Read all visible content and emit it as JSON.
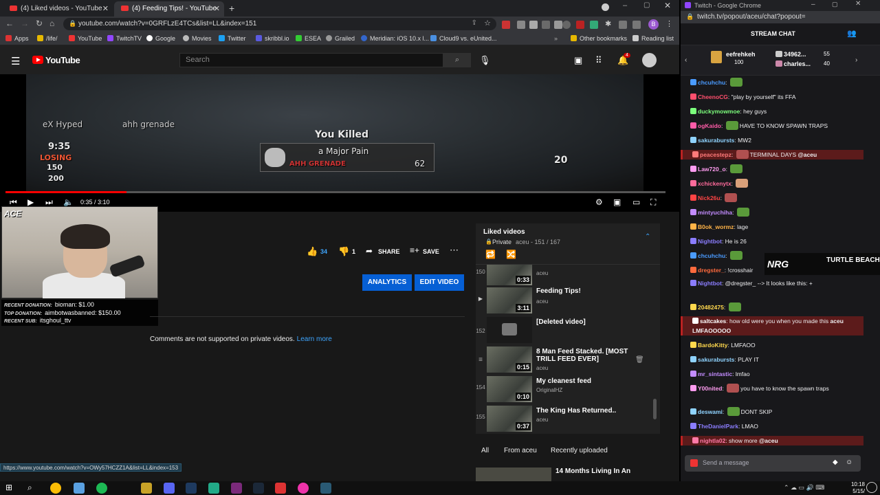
{
  "browser": {
    "tabs": [
      {
        "title": "(4) Liked videos - YouTube"
      },
      {
        "title": "(4) Feeding Tips! - YouTube"
      }
    ],
    "url": "youtube.com/watch?v=0GRFLzE4TCs&list=LL&index=151",
    "bookmarks": [
      "Apps",
      "/life/",
      "YouTube",
      "TwitchTV",
      "Google",
      "Movies",
      "Twitter",
      "skribbl.io",
      "ESEA",
      "Grailed",
      "Meridian: iOS 10.x l...",
      "Cloud9 vs. eUnited..."
    ],
    "other_bookmarks": "Other bookmarks",
    "reading_list": "Reading list",
    "profile_initial": "B"
  },
  "youtube": {
    "logo": "YouTube",
    "search_placeholder": "Search",
    "notif_count": "4",
    "video": {
      "hud": {
        "killfeed1": "eX Hyped",
        "killfeed1b": "ahh grenade",
        "time": "9:35",
        "status": "LOSING",
        "score1": "150",
        "score2": "200",
        "you_killed": "You Killed",
        "victim": "a Major Pain",
        "weapon": "AHH GRENADE",
        "points": "62",
        "ammo": "20"
      },
      "progress": 0.183,
      "time_display": "0:35 / 3:10"
    },
    "actions": {
      "likes": "34",
      "dislikes": "1",
      "share": "SHARE",
      "save": "SAVE",
      "analytics": "ANALYTICS",
      "edit_video": "EDIT VIDEO"
    },
    "comments_note": "Comments are not supported on private videos.",
    "learn_more": "Learn more",
    "playlist": {
      "title": "Liked videos",
      "privacy": "Private",
      "meta": "aceu - 151 / 167",
      "items": [
        {
          "idx": "150",
          "title": "",
          "channel": "aceu",
          "duration": "0:33"
        },
        {
          "idx": "",
          "title": "Feeding Tips!",
          "channel": "aceu",
          "duration": "3:11"
        },
        {
          "idx": "152",
          "title": "[Deleted video]",
          "channel": "",
          "duration": ""
        },
        {
          "idx": "",
          "title": "8 Man Feed Stacked. [MOST TRILL FEED EVER]",
          "channel": "aceu",
          "duration": "0:15"
        },
        {
          "idx": "154",
          "title": "My cleanest feed",
          "channel": "OriginalHZ",
          "duration": "0:10"
        },
        {
          "idx": "155",
          "title": "The King Has Returned..",
          "channel": "aceu",
          "duration": "0:37"
        }
      ]
    },
    "chips": [
      "All",
      "From aceu",
      "Recently uploaded"
    ],
    "next_video_title": "14 Months Living In An",
    "status_url": "https://www.youtube.com/watch?v=OWy57HCZZ1A&list=LL&index=153"
  },
  "overlay": {
    "tag": "ACE",
    "recent_donation_label": "RECENT DONATION:",
    "recent_donation": "bioman: $1.00",
    "top_donation_label": "TOP DONATION:",
    "top_donation": "aimbotwasbanned: $150.00",
    "recent_sub_label": "RECENT SUB:",
    "recent_sub": "itsghoul_ttv"
  },
  "twitch": {
    "window_title": "Twitch - Google Chrome",
    "url": "twitch.tv/popout/aceu/chat?popout=",
    "header": "STREAM CHAT",
    "gifts": [
      {
        "user": "eefrehkeh",
        "count": "100"
      },
      {
        "user": "34962...",
        "count": "55"
      },
      {
        "user": "charles...",
        "count": "40"
      }
    ],
    "messages": [
      {
        "user": "chcuhchu",
        "color": "#4a9bff",
        "text": "",
        "hl": false
      },
      {
        "user": "CheenoCG",
        "color": "#ff4f6d",
        "text": "\"play by yourself\" its FFA",
        "hl": false
      },
      {
        "user": "duckymowmoe",
        "color": "#7dff7d",
        "text": "hey guys",
        "hl": false
      },
      {
        "user": "ogKaido",
        "color": "#ff5ca8",
        "text": "HAVE TO KNOW SPAWN TRAPS",
        "hl": false
      },
      {
        "user": "sakurabursts",
        "color": "#8fd3ff",
        "text": "MW2",
        "hl": false
      },
      {
        "user": "peacestepz",
        "color": "#ff7a7a",
        "text": "TERMINAL DAYS",
        "mention": "@aceu",
        "hl": true
      },
      {
        "user": "Law720_o",
        "color": "#ff9cf0",
        "text": "",
        "hl": false
      },
      {
        "user": "xchickenytx",
        "color": "#ff6b9b",
        "text": "",
        "hl": false
      },
      {
        "user": "Nick26u",
        "color": "#ff4444",
        "text": "",
        "hl": false
      },
      {
        "user": "mintyuchiha",
        "color": "#c38cff",
        "text": "",
        "hl": false
      },
      {
        "user": "B0ok_wormz",
        "color": "#ffb347",
        "text": "lage",
        "hl": false
      },
      {
        "user": "Nightbot",
        "color": "#8b7dff",
        "text": "He is 26",
        "hl": false
      },
      {
        "user": "chcuhchu",
        "color": "#4a9bff",
        "text": "",
        "hl": false
      },
      {
        "user": "dregster_",
        "color": "#ff6a3d",
        "text": "!crosshair",
        "hl": false
      },
      {
        "user": "Nightbot",
        "color": "#8b7dff",
        "text": "@dregster_ --> It looks like this: +",
        "hl": false
      },
      {
        "user": "20482475",
        "color": "#ffd84d",
        "text": "",
        "hl": false
      },
      {
        "user": "saltcakes",
        "color": "#ffffff",
        "text": "how old were you when you made this",
        "mention": "aceu LMFAOOOOO",
        "hl": true
      },
      {
        "user": "BardoKitty",
        "color": "#ffd84d",
        "text": "LMFAOO",
        "hl": false
      },
      {
        "user": "sakurabursts",
        "color": "#8fd3ff",
        "text": "PLAY IT",
        "hl": false
      },
      {
        "user": "mr_sintastic",
        "color": "#c38cff",
        "text": "lmfao",
        "hl": false
      },
      {
        "user": "Y00nited",
        "color": "#ff9cf0",
        "text": "you have to know the spawn traps",
        "hl": false
      },
      {
        "user": "deswami",
        "color": "#8fd3ff",
        "text": "DONT SKIP",
        "hl": false
      },
      {
        "user": "TheDanielPark",
        "color": "#8b7dff",
        "text": "LMAO",
        "hl": false
      },
      {
        "user": "nightla02",
        "color": "#ff7aa8",
        "text": "show more",
        "mention": "@aceu",
        "hl": true
      }
    ],
    "input_placeholder": "Send a message",
    "sponsor1": "NRG",
    "sponsor2": "TURTLE BEACH"
  },
  "taskbar": {
    "time": "10:18",
    "date": "5/15/"
  }
}
